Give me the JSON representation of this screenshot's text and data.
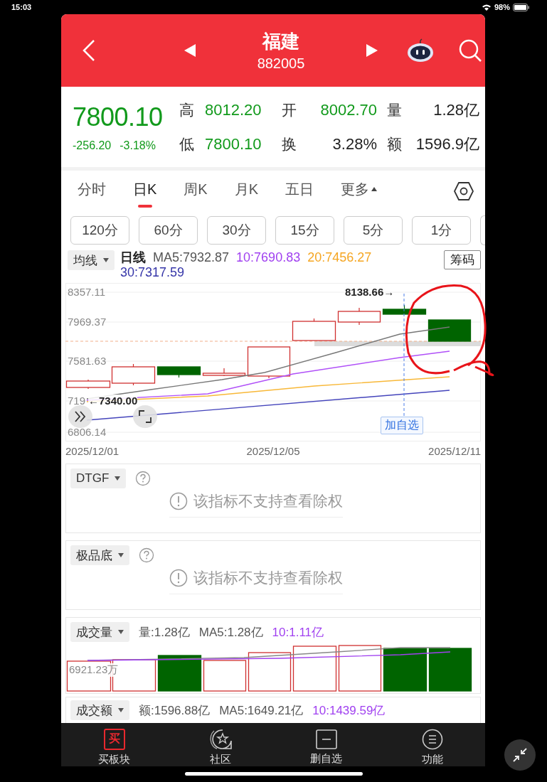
{
  "status_bar": {
    "time": "15:03",
    "battery": "98%"
  },
  "header": {
    "title": "福建",
    "code": "882005"
  },
  "quote": {
    "price": "7800.10",
    "change": "-256.20",
    "change_pct": "-3.18%",
    "stats": [
      {
        "label": "高",
        "value": "8012.20",
        "color": "#129a1c"
      },
      {
        "label": "开",
        "value": "8002.70",
        "color": "#129a1c"
      },
      {
        "label": "量",
        "value": "1.28亿",
        "color": "#222222"
      },
      {
        "label": "低",
        "value": "7800.10",
        "color": "#129a1c"
      },
      {
        "label": "换",
        "value": "3.28%",
        "color": "#222222"
      },
      {
        "label": "额",
        "value": "1596.9亿",
        "color": "#222222"
      }
    ]
  },
  "tabs": [
    {
      "label": "分时",
      "selected": false,
      "kind": "plain"
    },
    {
      "label": "日K",
      "selected": true,
      "kind": "plain"
    },
    {
      "label": "周K",
      "selected": false,
      "kind": "plain"
    },
    {
      "label": "月K",
      "selected": false,
      "kind": "plain"
    },
    {
      "label": "五日",
      "selected": false,
      "kind": "plain"
    },
    {
      "label": "更多",
      "selected": false,
      "kind": "menu"
    }
  ],
  "intervals": [
    "120分",
    "60分",
    "30分",
    "15分",
    "5分",
    "1分"
  ],
  "ma_bar": {
    "selector": "均线",
    "period": "日线",
    "chips_button": "筹码",
    "values": [
      {
        "text": "MA5:7932.87",
        "color": "#555555"
      },
      {
        "text": "10:7690.83",
        "color": "#a040f0"
      },
      {
        "text": "20:7456.27",
        "color": "#f5a623"
      },
      {
        "text": "30:7317.59",
        "color": "#3535a8"
      }
    ]
  },
  "chart": {
    "y_labels": [
      "8357.11",
      "7969.37",
      "7581.63",
      "719",
      "6806.14"
    ],
    "high_marker": "8138.66→",
    "low_marker": "←7340.00",
    "add_button": "加自选",
    "dates": [
      "2025/12/01",
      "2025/12/05",
      "2025/12/11"
    ]
  },
  "indicators": [
    {
      "name": "DTGF",
      "message": "该指标不支持查看除权"
    },
    {
      "name": "极品底",
      "message": "该指标不支持查看除权"
    }
  ],
  "volume": {
    "selector": "成交量",
    "axis_label": "6921.23万",
    "values": [
      {
        "text": "量:1.28亿",
        "color": "#555555"
      },
      {
        "text": "MA5:1.28亿",
        "color": "#555555"
      },
      {
        "text": "10:1.11亿",
        "color": "#a040f0"
      }
    ]
  },
  "amount": {
    "selector": "成交额",
    "values": [
      {
        "text": "额:1596.88亿",
        "color": "#555555"
      },
      {
        "text": "MA5:1649.21亿",
        "color": "#555555"
      },
      {
        "text": "10:1439.59亿",
        "color": "#a040f0"
      }
    ]
  },
  "nav": [
    {
      "label": "买板块",
      "kind": "buy",
      "icon_text": "买"
    },
    {
      "label": "社区",
      "kind": "community"
    },
    {
      "label": "删自选",
      "kind": "remove"
    },
    {
      "label": "功能",
      "kind": "menu"
    }
  ]
}
